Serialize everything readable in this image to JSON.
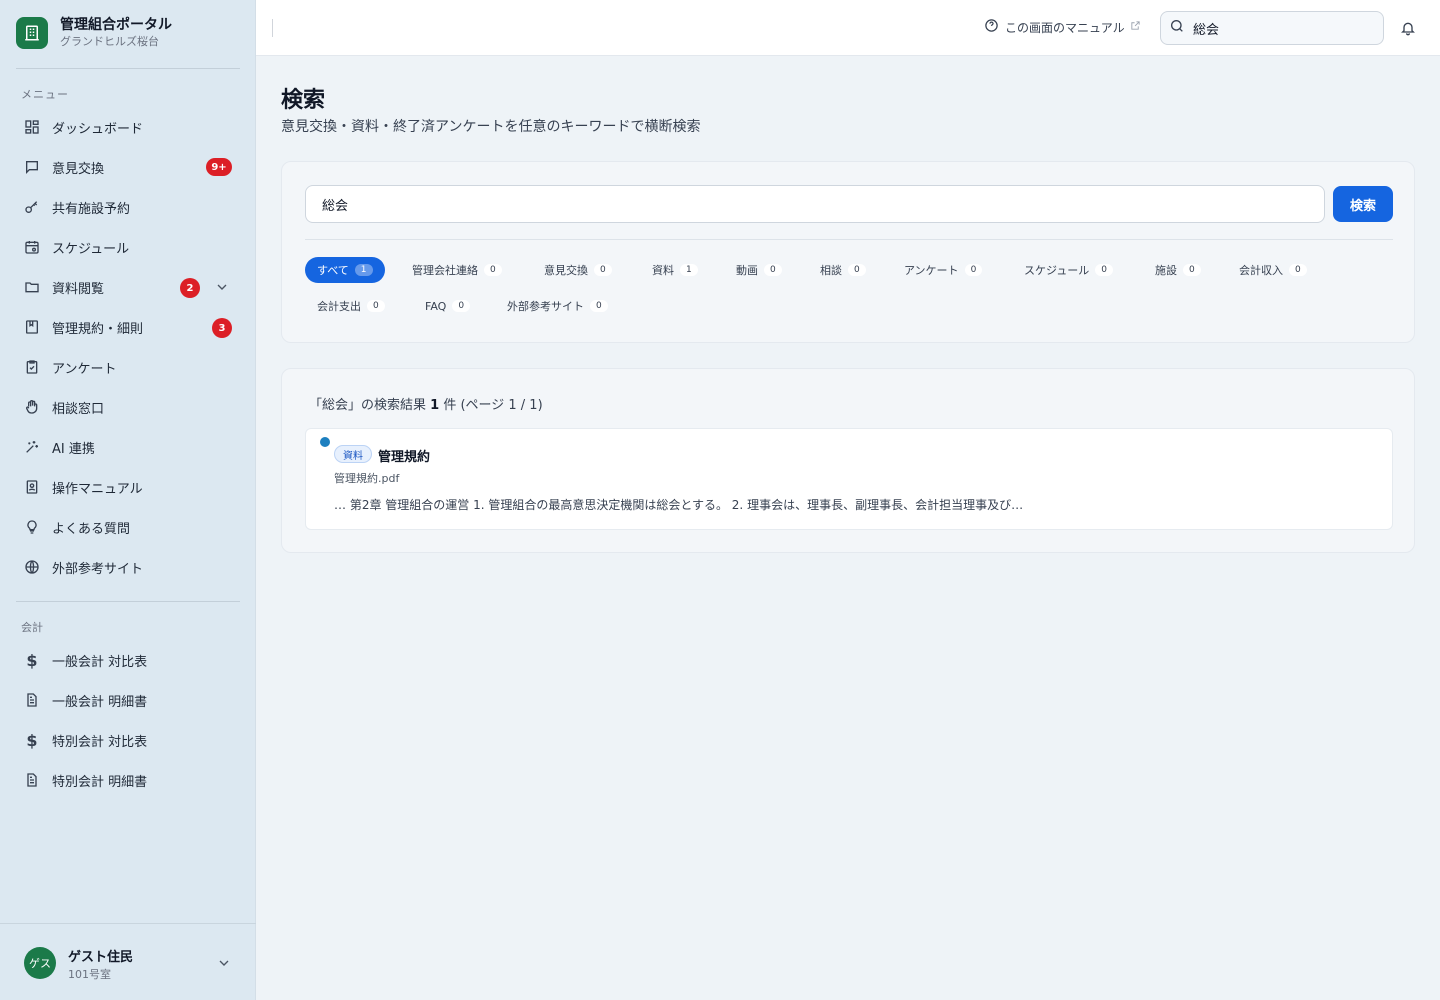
{
  "brand": {
    "title": "管理組合ポータル",
    "subtitle": "グランドヒルズ桜台"
  },
  "sidebar": {
    "menu_label": "メニュー",
    "items": [
      {
        "label": "ダッシュボード",
        "icon": "dashboard-icon"
      },
      {
        "label": "意見交換",
        "icon": "chat-icon",
        "badge": "9+"
      },
      {
        "label": "共有施設予約",
        "icon": "key-icon"
      },
      {
        "label": "スケジュール",
        "icon": "calendar-icon"
      },
      {
        "label": "資料閲覧",
        "icon": "folder-icon",
        "badge": "2",
        "expandable": true
      },
      {
        "label": "管理規約・細則",
        "icon": "book-icon",
        "badge": "3"
      },
      {
        "label": "アンケート",
        "icon": "clipboard-icon"
      },
      {
        "label": "相談窓口",
        "icon": "hand-icon"
      },
      {
        "label": "AI 連携",
        "icon": "sparkle-icon"
      },
      {
        "label": "操作マニュアル",
        "icon": "manual-icon"
      },
      {
        "label": "よくある質問",
        "icon": "lightbulb-icon"
      },
      {
        "label": "外部参考サイト",
        "icon": "globe-icon"
      }
    ],
    "accounting_label": "会計",
    "accounting_items": [
      {
        "label": "一般会計 対比表",
        "icon": "dollar-icon"
      },
      {
        "label": "一般会計 明細書",
        "icon": "document-icon"
      },
      {
        "label": "特別会計 対比表",
        "icon": "dollar-icon"
      },
      {
        "label": "特別会計 明細書",
        "icon": "document-icon"
      }
    ],
    "user": {
      "avatar": "ゲス",
      "name": "ゲスト住民",
      "room": "101号室"
    }
  },
  "header": {
    "manual_link": "この画面のマニュアル",
    "search_value": "総会"
  },
  "main": {
    "title": "検索",
    "subtitle": "意見交換・資料・終了済アンケートを任意のキーワードで横断検索",
    "search_value": "総会",
    "search_button": "検索",
    "filters": [
      {
        "label": "すべて",
        "count": "1",
        "active": true
      },
      {
        "label": "管理会社連絡",
        "count": "0"
      },
      {
        "label": "意見交換",
        "count": "0"
      },
      {
        "label": "資料",
        "count": "1"
      },
      {
        "label": "動画",
        "count": "0"
      },
      {
        "label": "相談",
        "count": "0"
      },
      {
        "label": "アンケート",
        "count": "0"
      },
      {
        "label": "スケジュール",
        "count": "0"
      },
      {
        "label": "施設",
        "count": "0"
      },
      {
        "label": "会計収入",
        "count": "0"
      },
      {
        "label": "会計支出",
        "count": "0"
      },
      {
        "label": "FAQ",
        "count": "0"
      },
      {
        "label": "外部参考サイト",
        "count": "0"
      }
    ],
    "summary_prefix": "「総会」の検索結果 ",
    "summary_count": "1",
    "summary_suffix": " 件 (ページ 1 / 1)",
    "results": [
      {
        "tag": "資料",
        "title": "管理規約",
        "file": "管理規約.pdf",
        "snippet": "… 第2章 管理組合の運営 1. 管理組合の最高意思決定機関は総会とする。 2. 理事会は、理事長、副理事長、会計担当理事及び…"
      }
    ]
  },
  "colors": {
    "accent": "#1565e0",
    "brand": "#1b7a49",
    "badge": "#dc1f26"
  }
}
